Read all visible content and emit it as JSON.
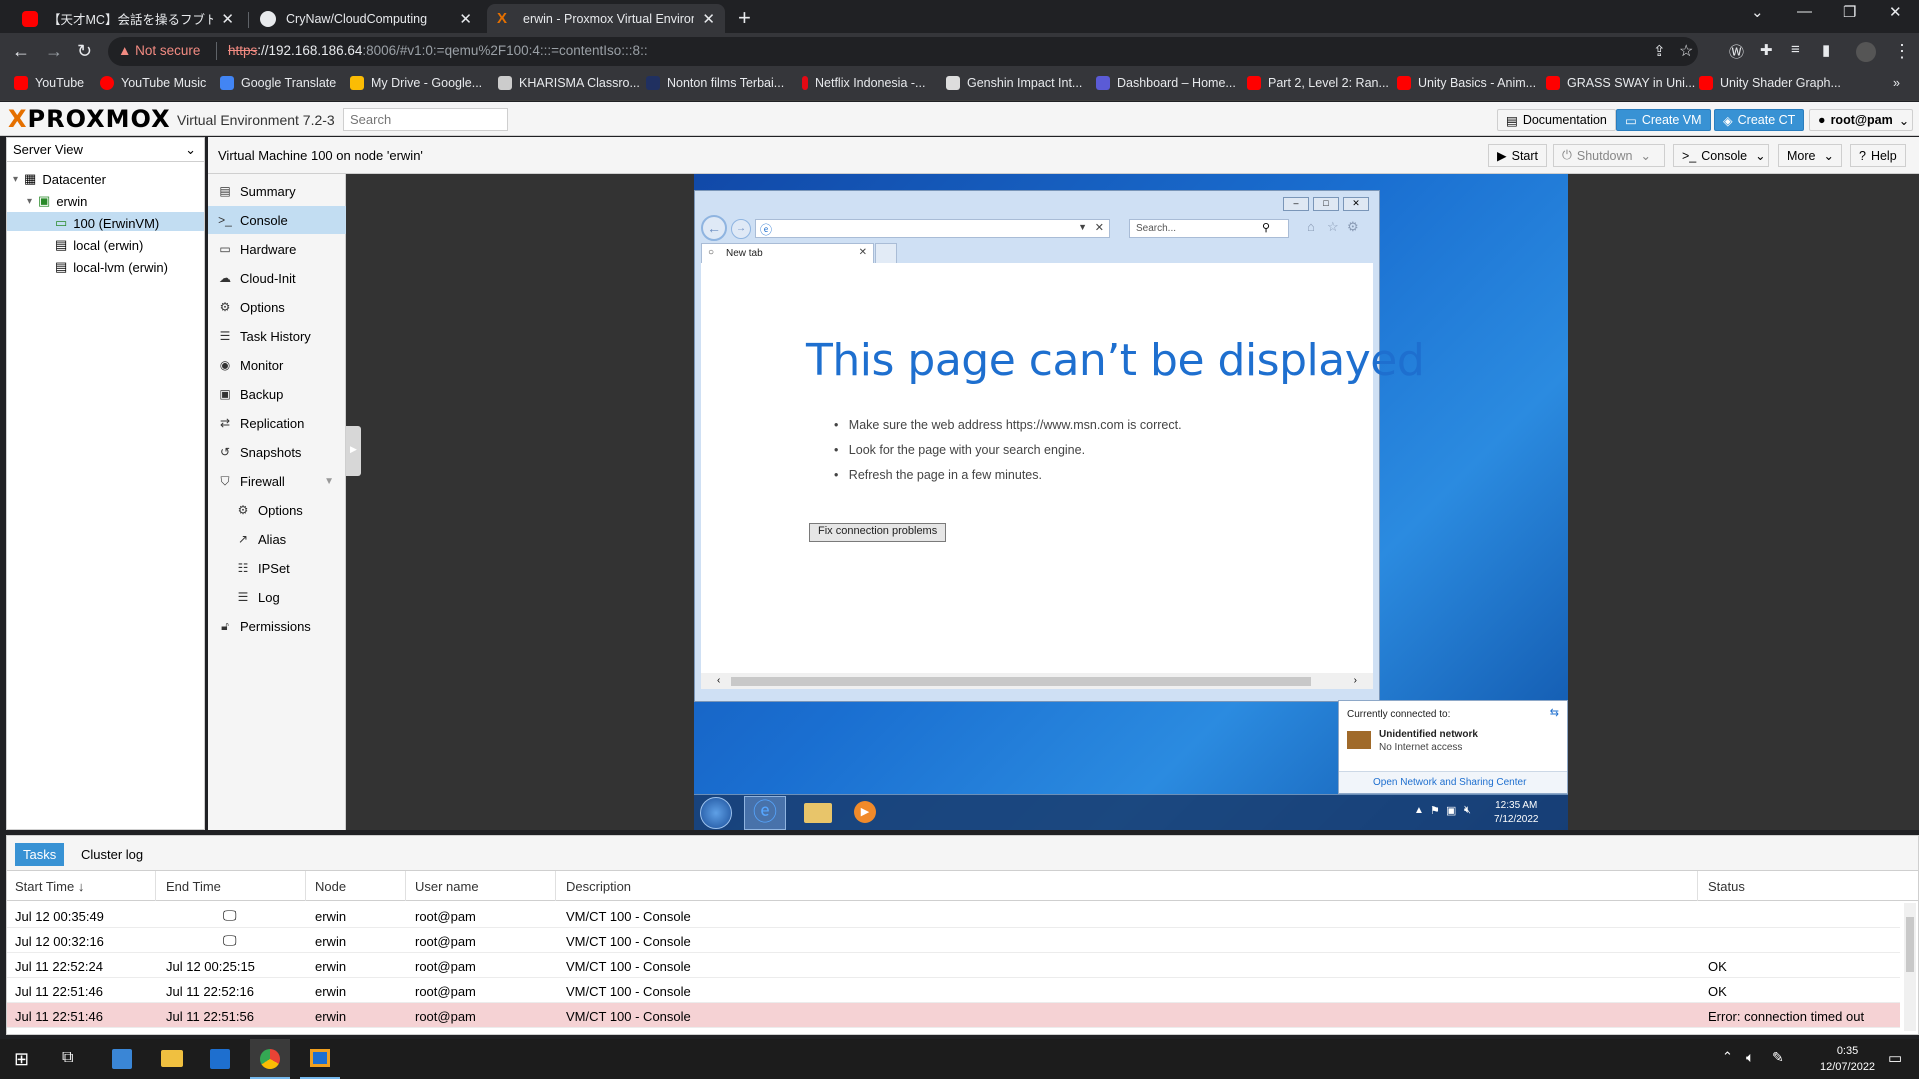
{
  "browser": {
    "tabs": [
      {
        "title": "【天才MC】会話を操るフブトーク！！",
        "favicon": "youtube-icon"
      },
      {
        "title": "CryNaw/CloudComputing",
        "favicon": "github-icon"
      },
      {
        "title": "erwin - Proxmox Virtual Environm",
        "favicon": "proxmox-icon"
      }
    ],
    "not_secure_label": "Not secure",
    "url_scheme": "https",
    "url_host": "://192.168.186.64",
    "url_rest": ":8006/#v1:0:=qemu%2F100:4:::=contentIso:::8::",
    "bookmarks": [
      "YouTube",
      "YouTube Music",
      "Google Translate",
      "My Drive - Google...",
      "KHARISMA Classro...",
      "Nonton films Terbai...",
      "Netflix Indonesia -...",
      "Genshin Impact Int...",
      "Dashboard – Home...",
      "Part 2, Level 2: Ran...",
      "Unity Basics - Anim...",
      "GRASS SWAY in Uni...",
      "Unity Shader Graph..."
    ]
  },
  "pve": {
    "logo_x": "X",
    "logo_text": "PROXMOX",
    "version": "Virtual Environment 7.2-3",
    "search_placeholder": "Search",
    "header_buttons": {
      "documentation": "Documentation",
      "create_vm": "Create VM",
      "create_ct": "Create CT",
      "user": "root@pam"
    },
    "server_view": "Server View",
    "tree": {
      "datacenter": "Datacenter",
      "node": "erwin",
      "vm": "100 (ErwinVM)",
      "storage1": "local (erwin)",
      "storage2": "local-lvm (erwin)"
    },
    "content_title": "Virtual Machine 100 on node 'erwin'",
    "content_buttons": {
      "start": "Start",
      "shutdown": "Shutdown",
      "console": "Console",
      "more": "More",
      "help": "Help"
    },
    "menu": {
      "summary": "Summary",
      "console": "Console",
      "hardware": "Hardware",
      "cloudinit": "Cloud-Init",
      "options": "Options",
      "taskhistory": "Task History",
      "monitor": "Monitor",
      "backup": "Backup",
      "replication": "Replication",
      "snapshots": "Snapshots",
      "firewall": "Firewall",
      "fw_options": "Options",
      "fw_alias": "Alias",
      "fw_ipset": "IPSet",
      "fw_log": "Log",
      "permissions": "Permissions"
    }
  },
  "vm": {
    "ie_search_placeholder": "Search...",
    "ie_tab": "New tab",
    "heading": "This page can’t be displayed",
    "bullets": [
      "Make sure the web address https://www.msn.com is correct.",
      "Look for the page with your search engine.",
      "Refresh the page in a few minutes."
    ],
    "fix_button": "Fix connection problems",
    "network_popup": {
      "connected_to": "Currently connected to:",
      "network": "Unidentified network",
      "status": "No Internet access",
      "link": "Open Network and Sharing Center"
    },
    "clock_time": "12:35 AM",
    "clock_date": "7/12/2022"
  },
  "tasks": {
    "tabs": {
      "tasks": "Tasks",
      "cluster_log": "Cluster log"
    },
    "columns": {
      "start": "Start Time ↓",
      "end": "End Time",
      "node": "Node",
      "user": "User name",
      "desc": "Description",
      "status": "Status"
    },
    "rows": [
      {
        "start": "Jul 12 00:35:49",
        "end": "",
        "node": "erwin",
        "user": "root@pam",
        "desc": "VM/CT 100 - Console",
        "status": "",
        "running": true
      },
      {
        "start": "Jul 12 00:32:16",
        "end": "",
        "node": "erwin",
        "user": "root@pam",
        "desc": "VM/CT 100 - Console",
        "status": "",
        "running": true
      },
      {
        "start": "Jul 11 22:52:24",
        "end": "Jul 12 00:25:15",
        "node": "erwin",
        "user": "root@pam",
        "desc": "VM/CT 100 - Console",
        "status": "OK"
      },
      {
        "start": "Jul 11 22:51:46",
        "end": "Jul 11 22:52:16",
        "node": "erwin",
        "user": "root@pam",
        "desc": "VM/CT 100 - Console",
        "status": "OK"
      },
      {
        "start": "Jul 11 22:51:46",
        "end": "Jul 11 22:51:56",
        "node": "erwin",
        "user": "root@pam",
        "desc": "VM/CT 100 - Console",
        "status": "Error: connection timed out",
        "error": true
      }
    ]
  },
  "windows": {
    "clock_time": "0:35",
    "clock_date": "12/07/2022"
  },
  "colors": {
    "proxmox_orange": "#e57000",
    "pve_blue": "#3892d4",
    "selection": "#c2ddf2",
    "error_row": "#f5d2d4"
  }
}
